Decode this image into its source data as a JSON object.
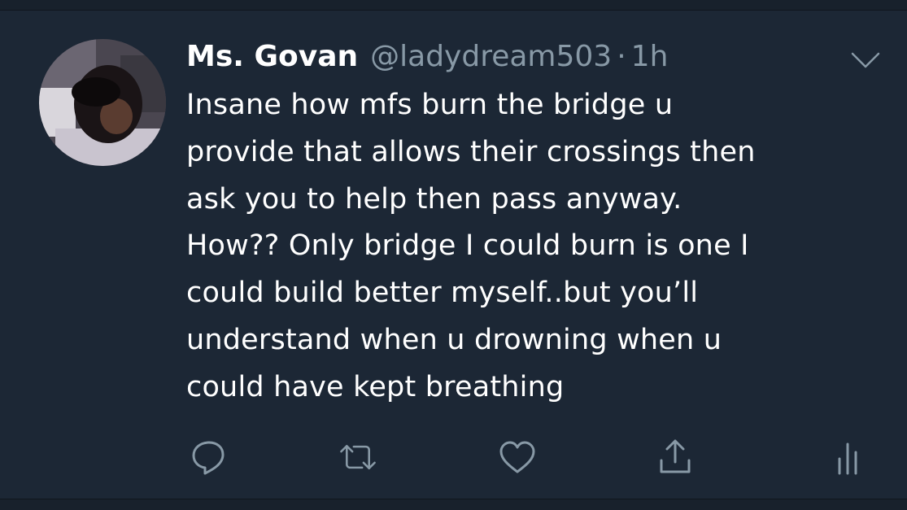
{
  "tweet": {
    "display_name": "Ms. Govan",
    "handle": "@ladydream503",
    "separator": "·",
    "timestamp": "1h",
    "text": "Insane how mfs burn the bridge u\nprovide that allows their crossings then\nask you to help then pass anyway.\nHow?? Only bridge I could burn is one I\ncould build better myself..but you’ll\nunderstand when u drowning when u\ncould have kept breathing"
  },
  "icons": {
    "avatar": "user-avatar-photo",
    "menu": "chevron-down-icon",
    "reply": "reply-icon",
    "retweet": "retweet-icon",
    "like": "heart-icon",
    "share": "share-icon",
    "analytics": "analytics-icon"
  },
  "colors": {
    "background": "#1c2735",
    "text_primary": "#ffffff",
    "text_secondary": "#8899a6"
  }
}
